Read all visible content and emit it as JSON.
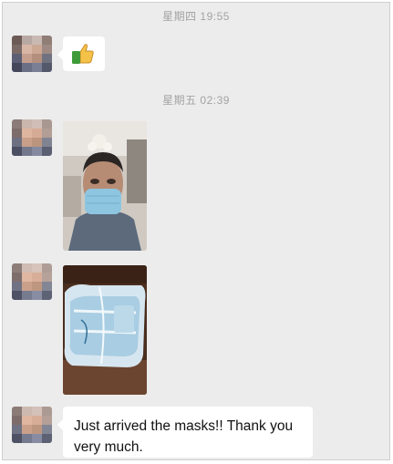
{
  "conversation": {
    "timestamps": {
      "first": "星期四 19:55",
      "second": "星期五 02:39"
    },
    "messages": [
      {
        "type": "emoji",
        "icon": "thumbs-up-icon",
        "glyph": "👍"
      },
      {
        "type": "image",
        "subject": "selfie-with-mask"
      },
      {
        "type": "image",
        "subject": "packaged-masks"
      },
      {
        "type": "text",
        "text": "Just arrived the masks!! Thank you very much."
      }
    ]
  },
  "colors": {
    "background": "#ececec",
    "bubble": "#ffffff",
    "timestamp": "#a3a3a3"
  }
}
